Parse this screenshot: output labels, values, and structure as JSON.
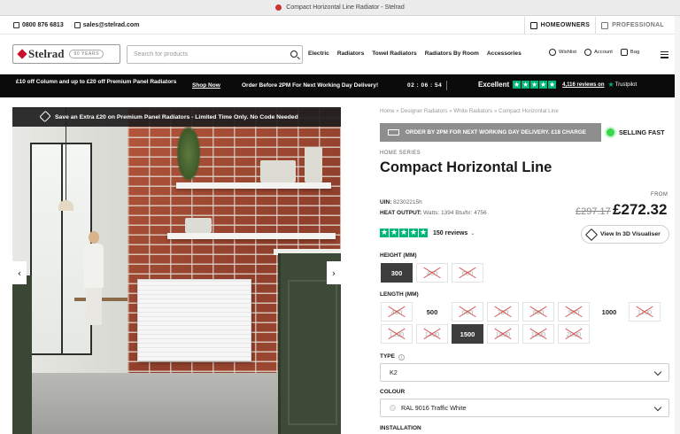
{
  "window": {
    "tab_title": "Compact Horizontal Line Radiator - Stelrad"
  },
  "topbar": {
    "phone": "0800 876 6813",
    "email": "sales@stelrad.com",
    "homeowners": "HOMEOWNERS",
    "professional": "PROFESSIONAL"
  },
  "header": {
    "logo_text": "Stelrad",
    "logo_badge": "90 YEARS",
    "search_placeholder": "Search for products",
    "nav": [
      "Electric",
      "Radiators",
      "Towel Radiators",
      "Radiators By Room",
      "Accessories"
    ],
    "wishlist": "Wishlist",
    "account": "Account",
    "bag": "Bag",
    "bag_count": "0"
  },
  "promo": {
    "offer": "£10 off Column and up to £20 off Premium Panel Radiators",
    "shop_now": "Shop Now",
    "delivery": "Order Before 2PM For Next Working Day Delivery!",
    "countdown": "02 : 06 : 54",
    "trust_label": "Excellent",
    "trust_reviews": "4,116 reviews on",
    "trust_brand": "Trustpilot",
    "trust_color": "#00b67a"
  },
  "gallery": {
    "banner": "Save an Extra £20 on Premium Panel Radiators - Limited Time Only. No Code Needed",
    "prev": "‹",
    "next": "›"
  },
  "product": {
    "breadcrumb": "Home » Designer Radiators » White Radiators » Compact Horizontal Line",
    "delivery_banner": "ORDER BY 2PM FOR NEXT WORKING DAY DELIVERY. £18 CHARGE",
    "selling_fast": "SELLING FAST",
    "series": "HOME SERIES",
    "title": "Compact Horizontal Line",
    "uin_label": "UIN:",
    "uin_value": "82302215h",
    "heat_label": "HEAT OUTPUT:",
    "heat_value": "Watts: 1394 Btu/hr: 4756",
    "from_label": "FROM",
    "old_price": "£297.17",
    "price": "£272.32",
    "review_count": "150 reviews",
    "visualiser": "View In 3D Visualiser"
  },
  "options": {
    "height_label": "HEIGHT (MM)",
    "heights": [
      {
        "value": "300",
        "state": "selected"
      },
      {
        "value": "450",
        "state": "unavailable"
      },
      {
        "value": "600",
        "state": "unavailable"
      }
    ],
    "length_label": "LENGTH (MM)",
    "lengths": [
      {
        "value": "400",
        "state": "unavailable"
      },
      {
        "value": "500",
        "state": "available"
      },
      {
        "value": "600",
        "state": "unavailable"
      },
      {
        "value": "700",
        "state": "unavailable"
      },
      {
        "value": "800",
        "state": "unavailable"
      },
      {
        "value": "900",
        "state": "unavailable"
      },
      {
        "value": "1000",
        "state": "available"
      },
      {
        "value": "1100",
        "state": "unavailable"
      },
      {
        "value": "1200",
        "state": "unavailable"
      },
      {
        "value": "1400",
        "state": "unavailable"
      },
      {
        "value": "1500",
        "state": "selected"
      },
      {
        "value": "1600",
        "state": "unavailable"
      },
      {
        "value": "1800",
        "state": "unavailable"
      },
      {
        "value": "2000",
        "state": "unavailable"
      }
    ],
    "type_label": "TYPE",
    "type_value": "K2",
    "colour_label": "COLOUR",
    "colour_value": "RAL 9016 Traffic White",
    "installation_label": "INSTALLATION"
  }
}
